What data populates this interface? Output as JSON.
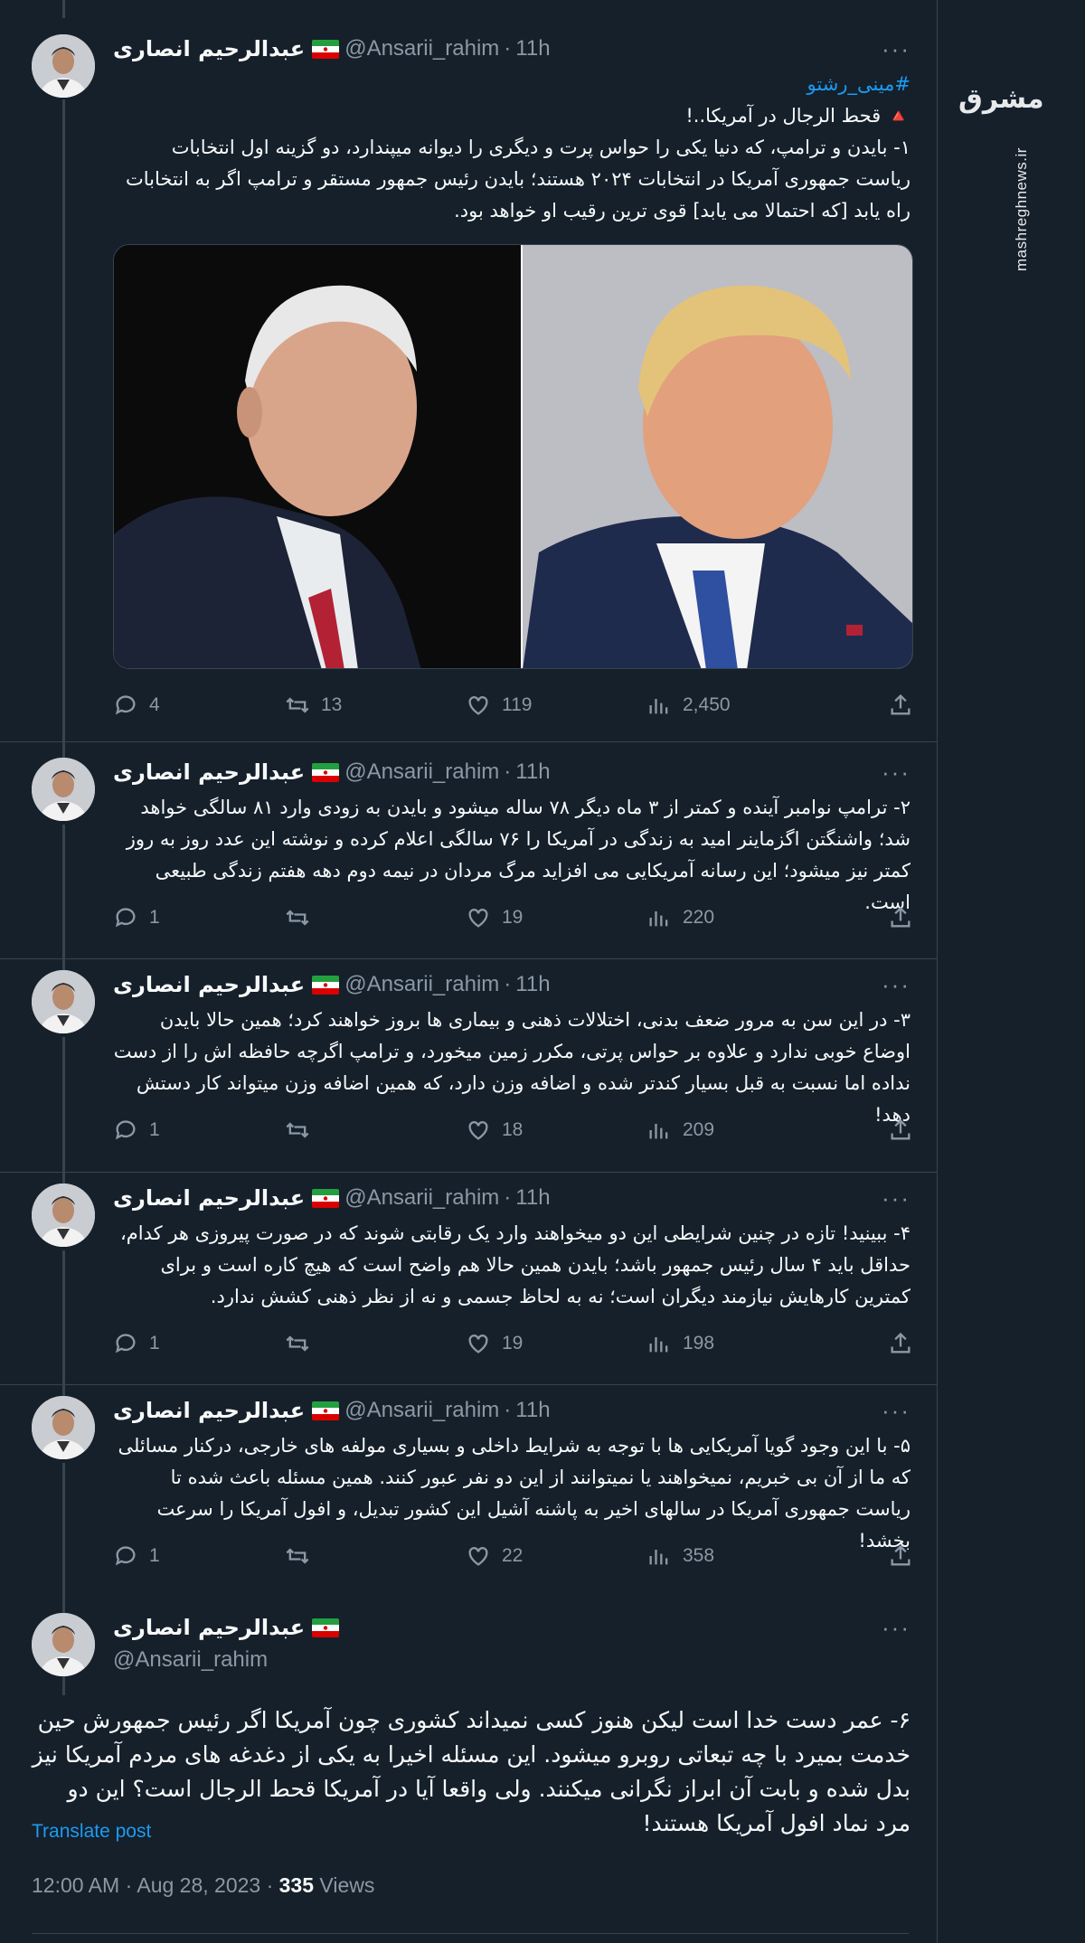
{
  "author": {
    "name": "عبدالرحیم انصاری",
    "handle": "@Ansarii_rahim",
    "time_sep": "·",
    "time": "11h"
  },
  "more_label": "···",
  "watermark": {
    "site": "mashreghnews.ir",
    "logo": "مشرق"
  },
  "tweets": [
    {
      "hashtag": "#مینی_رشتو",
      "title": "🔺 قحط الرجال در آمریکا..!",
      "text": "۱- بایدن و ترامپ، که دنیا یکی را حواس پرت و دیگری را دیوانه میپندارد، دو گزینه اول انتخابات ریاست جمهوری آمریکا در انتخابات ۲۰۲۴ هستند؛ بایدن رئیس جمهور مستقر و ترامپ اگر به انتخابات راه یابد [که احتمالا می یابد] قوی ترین رقیب او خواهد بود.",
      "replies": "4",
      "retweets": "13",
      "likes": "119",
      "views": "2,450"
    },
    {
      "text": "۲- ترامپ نوامبر آینده و کمتر از ۳ ماه دیگر ۷۸ ساله میشود و بایدن به زودی وارد ۸۱ سالگی خواهد شد؛ واشنگتن اگزماینر امید به زندگی در آمریکا را ۷۶ سالگی اعلام کرده و نوشته این عدد روز به روز کمتر نیز میشود؛ این رسانه آمریکایی می افزاید مرگ مردان در نیمه دوم دهه هفتم زندگی طبیعی است.",
      "replies": "1",
      "retweets": "",
      "likes": "19",
      "views": "220"
    },
    {
      "text": "۳- در این سن به مرور ضعف بدنی، اختلالات ذهنی و بیماری ها بروز خواهند کرد؛ همین حالا بایدن اوضاع خوبی ندارد و علاوه بر حواس پرتی، مکرر زمین میخورد، و ترامپ اگرچه حافظه اش را از دست نداده اما نسبت به قبل بسیار کندتر شده و اضافه وزن دارد، که همین اضافه وزن میتواند کار دستش دهد!",
      "replies": "1",
      "retweets": "",
      "likes": "18",
      "views": "209"
    },
    {
      "text": "۴- ببینید! تازه در چنین شرایطی این دو میخواهند وارد یک رقابتی شوند که در صورت پیروزی هر کدام، حداقل باید ۴ سال رئیس جمهور باشد؛ بایدن همین حالا هم واضح است که هیچ کاره است و برای کمترین کارهایش نیازمند دیگران است؛ نه به لحاظ جسمی و نه از نظر ذهنی کشش ندارد.",
      "replies": "1",
      "retweets": "",
      "likes": "19",
      "views": "198"
    },
    {
      "text": "۵- با این وجود گویا آمریکایی ها با توجه به شرایط داخلی و بسیاری مولفه های خارجی، درکنار مسائلی که ما از آن بی خبریم، نمیخواهند یا نمیتوانند از این دو نفر عبور کنند. همین مسئله باعث شده تا ریاست جمهوری آمریکا در سالهای اخیر به پاشنه آشیل این کشور تبدیل، و افول آمریکا را سرعت بخشد!",
      "replies": "1",
      "retweets": "",
      "likes": "22",
      "views": "358"
    }
  ],
  "main_tweet": {
    "text": "۶- عمر دست خدا است لیکن هنوز کسی نمیداند کشوری چون آمریکا اگر رئیس جمهورش حین خدمت بمیرد با چه تبعاتی روبرو میشود. این مسئله اخیرا به یکی از دغدغه های مردم آمریکا نیز بدل شده و بابت آن ابراز نگرانی میکنند. ولی واقعا آیا در آمریکا قحط الرجال است؟ این دو مرد نماد افول آمریکا هستند!",
    "translate_label": "Translate post",
    "timestamp": "12:00 AM · Aug 28, 2023 · ",
    "views_count": "335",
    "views_label": " Views"
  }
}
